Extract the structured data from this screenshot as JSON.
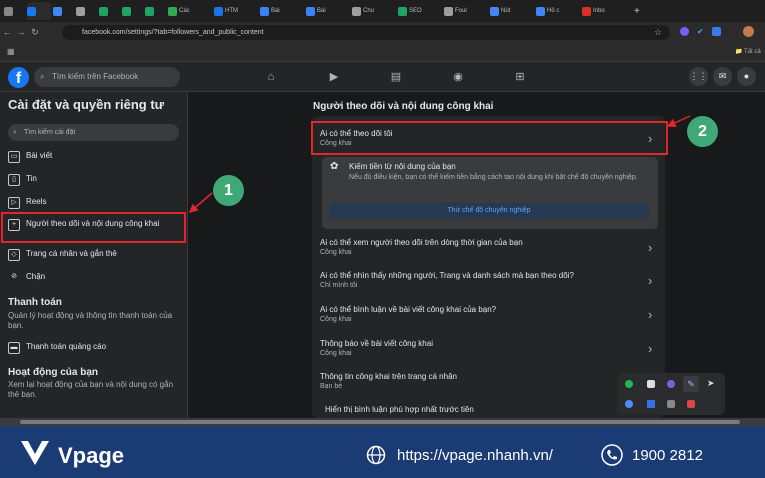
{
  "browser": {
    "tabs": [
      {
        "label": "",
        "color": "#888888"
      },
      {
        "label": "",
        "color": "#1877f2"
      },
      {
        "label": "",
        "color": "#4285f4"
      },
      {
        "label": "",
        "color": "#9e9e9e"
      },
      {
        "label": "",
        "color": "#1fa463"
      },
      {
        "label": "",
        "color": "#1fa463"
      },
      {
        "label": "",
        "color": "#1fa463"
      },
      {
        "label": "Các",
        "color": "#34a853"
      },
      {
        "label": "HTM",
        "color": "#1a73e8"
      },
      {
        "label": "Bài",
        "color": "#3b82f6"
      },
      {
        "label": "Bài",
        "color": "#3b82f6"
      },
      {
        "label": "Chu",
        "color": "#9e9e9e"
      },
      {
        "label": "SEO",
        "color": "#1fa463"
      },
      {
        "label": "Foul",
        "color": "#9e9e9e"
      },
      {
        "label": "Nút",
        "color": "#4285f4"
      },
      {
        "label": "Hồ c",
        "color": "#4285f4"
      },
      {
        "label": "Inbo",
        "color": "#d93025"
      }
    ],
    "new_tab": "+",
    "url": "facebook.com/settings/?tab=followers_and_public_content",
    "bookmark_folder": "Tất cả"
  },
  "fb": {
    "logo": "f",
    "search_placeholder": "Tìm kiếm trên Facebook"
  },
  "sidebar": {
    "title": "Cài đặt và quyền riêng tư",
    "search_placeholder": "Tìm kiếm cài đặt",
    "items": [
      {
        "label": "Bài viết",
        "icon": "post-icon"
      },
      {
        "label": "Tin",
        "icon": "story-icon"
      },
      {
        "label": "Reels",
        "icon": "reels-icon"
      },
      {
        "label": "Người theo dõi và nội dung công khai",
        "icon": "follower-icon"
      },
      {
        "label": "Trang cá nhân và gắn thẻ",
        "icon": "tag-icon"
      },
      {
        "label": "Chặn",
        "icon": "block-icon"
      }
    ],
    "payments_heading": "Thanh toán",
    "payments_desc": "Quản lý hoạt động và thông tin thanh toán của bạn.",
    "payments_item": "Thanh toán quảng cáo",
    "activity_heading": "Hoạt động của bạn",
    "activity_desc": "Xem lại hoạt động của bạn và nội dung có gắn thẻ bạn."
  },
  "main": {
    "title": "Người theo dõi và nội dung công khai",
    "rows": [
      {
        "title": "Ai có thể theo dõi tôi",
        "value": "Công khai"
      },
      {
        "title": "Ai có thể xem người theo dõi trên dòng thời gian của bạn",
        "value": "Công khai"
      },
      {
        "title": "Ai có thể nhìn thấy những người, Trang và danh sách mà bạn theo dõi?",
        "value": "Chỉ mình tôi"
      },
      {
        "title": "Ai có thể bình luận về bài viết công khai của bạn?",
        "value": "Công khai"
      },
      {
        "title": "Thông báo về bài viết công khai",
        "value": "Công khai"
      },
      {
        "title": "Thông tin công khai trên trang cá nhân",
        "value": "Bạn bè"
      },
      {
        "title": "Hiển thị bình luận phù hợp nhất trước tiên",
        "value": ""
      }
    ],
    "monetize": {
      "title": "Kiếm tiền từ nội dung của bạn",
      "desc": "Nếu đủ điều kiện, bạn có thể kiếm tiền bằng cách tạo nội dung khi bật chế độ chuyên nghiệp.",
      "button": "Thử chế độ chuyên nghiệp"
    }
  },
  "annotations": {
    "badge1": "1",
    "badge2": "2",
    "accent": "#e3262b",
    "badge_color": "#3fa876"
  },
  "footer": {
    "brand": "Vpage",
    "website": "https://vpage.nhanh.vn/",
    "phone": "1900 2812"
  }
}
